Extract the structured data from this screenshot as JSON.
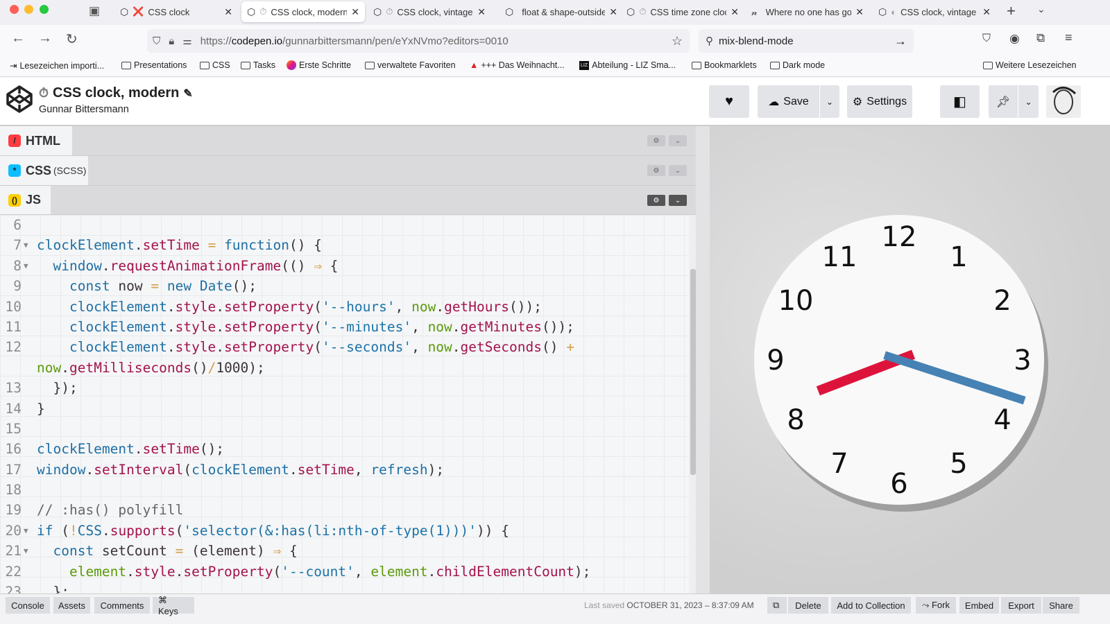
{
  "browser": {
    "tabs": [
      {
        "title": "CSS clock",
        "status": "❌"
      },
      {
        "title": "CSS clock, modern",
        "status": "⏱"
      },
      {
        "title": "CSS clock, vintage",
        "status": "⏱"
      },
      {
        "title": "float & shape-outside",
        "status": ""
      },
      {
        "title": "CSS time zone clock",
        "status": "⏱"
      },
      {
        "title": "Where no one has gone",
        "status": ""
      },
      {
        "title": "CSS clock, vintage",
        "status": "◐"
      }
    ],
    "url_prefix": "https://",
    "url_host": "codepen.io",
    "url_path": "/gunnarbittersmann/pen/eYxNVmo?editors=0010",
    "search_value": "mix-blend-mode",
    "bookmarks": [
      "Lesezeichen importi...",
      "Presentations",
      "CSS",
      "Tasks",
      "Erste Schritte",
      "verwaltete Favoriten",
      "+++ Das Weihnacht...",
      "Abteilung - LIZ Sma...",
      "Bookmarklets",
      "Dark mode"
    ],
    "other_bookmarks": "Weitere Lesezeichen",
    "liz_logo": "LIZ"
  },
  "codepen": {
    "title": "CSS clock, modern",
    "title_icon": "⏱",
    "author": "Gunnar Bittersmann",
    "save_label": "Save",
    "settings_label": "Settings"
  },
  "editors": [
    {
      "name": "HTML",
      "sub": "",
      "color": "#ff3c41",
      "glyph": "/"
    },
    {
      "name": "CSS",
      "sub": "(SCSS)",
      "color": "#0ebeff",
      "glyph": "*"
    },
    {
      "name": "JS",
      "sub": "",
      "color": "#fcd000",
      "glyph": "()"
    }
  ],
  "code": [
    {
      "n": "6",
      "f": false,
      "t": []
    },
    {
      "n": "7",
      "f": true,
      "t": [
        [
          "clockElement",
          "id"
        ],
        [
          ".",
          "pl"
        ],
        [
          "setTime",
          "fn"
        ],
        [
          " = ",
          "op"
        ],
        [
          "function",
          "id"
        ],
        [
          "() {",
          "pl"
        ]
      ]
    },
    {
      "n": "8",
      "f": true,
      "t": [
        [
          "  window",
          "id"
        ],
        [
          ".",
          "pl"
        ],
        [
          "requestAnimationFrame",
          "fn"
        ],
        [
          "(() ",
          "pl"
        ],
        [
          "⇒",
          "op"
        ],
        [
          " {",
          "pl"
        ]
      ]
    },
    {
      "n": "9",
      "f": false,
      "t": [
        [
          "    const",
          "id"
        ],
        [
          " now ",
          "pl"
        ],
        [
          "=",
          "op"
        ],
        [
          " new ",
          "id"
        ],
        [
          "Date",
          "id"
        ],
        [
          "();",
          "pl"
        ]
      ]
    },
    {
      "n": "10",
      "f": false,
      "t": [
        [
          "    clockElement",
          "id"
        ],
        [
          ".",
          "pl"
        ],
        [
          "style",
          "fn"
        ],
        [
          ".",
          "pl"
        ],
        [
          "setProperty",
          "fn"
        ],
        [
          "(",
          "pl"
        ],
        [
          "'--hours'",
          "str"
        ],
        [
          ", ",
          "pl"
        ],
        [
          "now",
          "var"
        ],
        [
          ".",
          "pl"
        ],
        [
          "getHours",
          "fn"
        ],
        [
          "());",
          "pl"
        ]
      ]
    },
    {
      "n": "11",
      "f": false,
      "t": [
        [
          "    clockElement",
          "id"
        ],
        [
          ".",
          "pl"
        ],
        [
          "style",
          "fn"
        ],
        [
          ".",
          "pl"
        ],
        [
          "setProperty",
          "fn"
        ],
        [
          "(",
          "pl"
        ],
        [
          "'--minutes'",
          "str"
        ],
        [
          ", ",
          "pl"
        ],
        [
          "now",
          "var"
        ],
        [
          ".",
          "pl"
        ],
        [
          "getMinutes",
          "fn"
        ],
        [
          "());",
          "pl"
        ]
      ]
    },
    {
      "n": "12",
      "f": false,
      "t": [
        [
          "    clockElement",
          "id"
        ],
        [
          ".",
          "pl"
        ],
        [
          "style",
          "fn"
        ],
        [
          ".",
          "pl"
        ],
        [
          "setProperty",
          "fn"
        ],
        [
          "(",
          "pl"
        ],
        [
          "'--seconds'",
          "str"
        ],
        [
          ", ",
          "pl"
        ],
        [
          "now",
          "var"
        ],
        [
          ".",
          "pl"
        ],
        [
          "getSeconds",
          "fn"
        ],
        [
          "() ",
          "pl"
        ],
        [
          "+",
          "op"
        ]
      ]
    },
    {
      "n": "",
      "f": false,
      "t": [
        [
          "now",
          "var"
        ],
        [
          ".",
          "pl"
        ],
        [
          "getMilliseconds",
          "fn"
        ],
        [
          "()",
          "pl"
        ],
        [
          "/",
          "op"
        ],
        [
          "1000);",
          "pl"
        ]
      ]
    },
    {
      "n": "13",
      "f": false,
      "t": [
        [
          "  });",
          "pl"
        ]
      ]
    },
    {
      "n": "14",
      "f": false,
      "t": [
        [
          "}",
          "pl"
        ]
      ]
    },
    {
      "n": "15",
      "f": false,
      "t": []
    },
    {
      "n": "16",
      "f": false,
      "t": [
        [
          "clockElement",
          "id"
        ],
        [
          ".",
          "pl"
        ],
        [
          "setTime",
          "fn"
        ],
        [
          "();",
          "pl"
        ]
      ]
    },
    {
      "n": "17",
      "f": false,
      "t": [
        [
          "window",
          "id"
        ],
        [
          ".",
          "pl"
        ],
        [
          "setInterval",
          "fn"
        ],
        [
          "(",
          "pl"
        ],
        [
          "clockElement",
          "id"
        ],
        [
          ".",
          "pl"
        ],
        [
          "setTime",
          "fn"
        ],
        [
          ", ",
          "pl"
        ],
        [
          "refresh",
          "id"
        ],
        [
          ");",
          "pl"
        ]
      ]
    },
    {
      "n": "18",
      "f": false,
      "t": []
    },
    {
      "n": "19",
      "f": false,
      "t": [
        [
          "// :has() polyfill",
          "cm"
        ]
      ]
    },
    {
      "n": "20",
      "f": true,
      "t": [
        [
          "if",
          "id"
        ],
        [
          " (",
          "pl"
        ],
        [
          "!",
          "op"
        ],
        [
          "CSS",
          "id"
        ],
        [
          ".",
          "pl"
        ],
        [
          "supports",
          "fn"
        ],
        [
          "(",
          "pl"
        ],
        [
          "'selector(&:has(li:nth-of-type(1)))'",
          "str"
        ],
        [
          ")) {",
          "pl"
        ]
      ]
    },
    {
      "n": "21",
      "f": true,
      "t": [
        [
          "  const",
          "id"
        ],
        [
          " setCount ",
          "pl"
        ],
        [
          "=",
          "op"
        ],
        [
          " (element) ",
          "pl"
        ],
        [
          "⇒",
          "op"
        ],
        [
          " {",
          "pl"
        ]
      ]
    },
    {
      "n": "22",
      "f": false,
      "t": [
        [
          "    element",
          "var"
        ],
        [
          ".",
          "pl"
        ],
        [
          "style",
          "fn"
        ],
        [
          ".",
          "pl"
        ],
        [
          "setProperty",
          "fn"
        ],
        [
          "(",
          "pl"
        ],
        [
          "'--count'",
          "str"
        ],
        [
          ", ",
          "pl"
        ],
        [
          "element",
          "var"
        ],
        [
          ".",
          "pl"
        ],
        [
          "childElementCount",
          "fn"
        ],
        [
          ");",
          "pl"
        ]
      ]
    },
    {
      "n": "23",
      "f": false,
      "t": [
        [
          "  };",
          "pl"
        ]
      ]
    }
  ],
  "clock": {
    "numbers": [
      "12",
      "1",
      "2",
      "3",
      "4",
      "5",
      "6",
      "7",
      "8",
      "9",
      "10",
      "11"
    ],
    "hours": 8,
    "minutes": 18,
    "hour_color": "#dc143c",
    "minute_color": "#4682b4"
  },
  "footer": {
    "left": [
      "Console",
      "Assets",
      "Comments",
      "⌘ Keys"
    ],
    "last_saved_label": "Last saved",
    "last_saved_value": "OCTOBER 31, 2023 – 8:37:09 AM",
    "right": [
      "Delete",
      "Add to Collection",
      "⤳ Fork",
      "Embed",
      "Export",
      "Share"
    ]
  }
}
